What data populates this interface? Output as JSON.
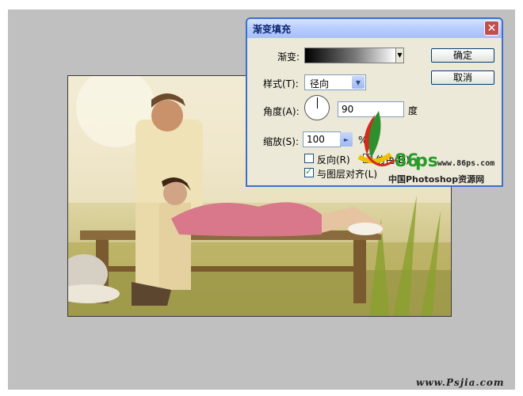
{
  "dialog": {
    "title": "渐变填充",
    "gradient_label": "渐变:",
    "style_label": "样式(T):",
    "style_value": "径向",
    "angle_label": "角度(A):",
    "angle_value": "90",
    "angle_unit": "度",
    "scale_label": "缩放(S):",
    "scale_value": "100",
    "scale_unit": "%",
    "reverse_label": "反向(R)",
    "reverse_checked": false,
    "dither_label": "仿色(D)",
    "dither_checked": false,
    "align_label": "与图层对齐(L)",
    "align_checked": true,
    "ok_label": "确定",
    "cancel_label": "取消",
    "close_icon": "close-icon"
  },
  "watermark": {
    "logo_text": "86ps",
    "logo_url": "www.86ps.com",
    "logo_caption": "中国Photoshop资源网",
    "bottom_text": "www.Psjia.com"
  },
  "colors": {
    "canvas_bg": "#c0c0c0",
    "dialog_bg": "#ece9d8",
    "title_text": "#0a246a",
    "border_blue": "#3b6fce"
  }
}
